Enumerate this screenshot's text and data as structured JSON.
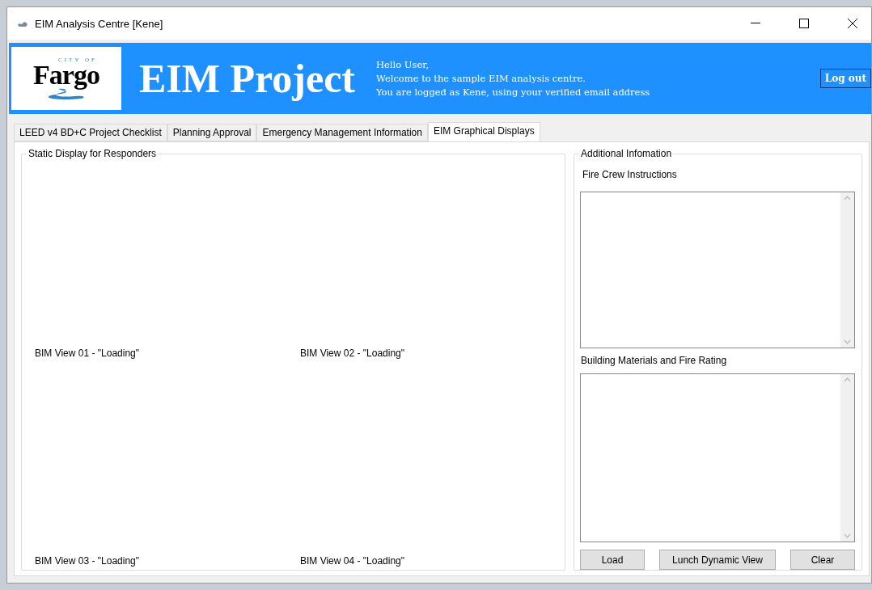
{
  "window": {
    "title": "EIM Analysis Centre  [Kene]"
  },
  "banner": {
    "logo_small": "CITY OF",
    "logo_main": "Fargo",
    "title": "EIM Project",
    "greeting": [
      "Hello User,",
      "Welcome to the sample EIM analysis centre.",
      "You are logged as Kene, using your verified email address"
    ],
    "logout": "Log out"
  },
  "tabs": [
    {
      "label": "LEED v4 BD+C Project Checklist",
      "selected": false
    },
    {
      "label": "Planning Approval",
      "selected": false
    },
    {
      "label": "Emergency Management Information",
      "selected": false
    },
    {
      "label": "EIM Graphical Displays",
      "selected": true
    }
  ],
  "static_display": {
    "title": "Static Display for Responders",
    "views": [
      "BIM View 01 - \"Loading\"",
      "BIM View 02 - \"Loading\"",
      "BIM View 03 - \"Loading\"",
      "BIM View 04 - \"Loading\""
    ]
  },
  "additional": {
    "title": "Additional Infomation",
    "fields": [
      {
        "label": "Fire Crew Instructions"
      },
      {
        "label": "Building Materials and Fire Rating"
      }
    ],
    "buttons": [
      "Load",
      "Lunch Dynamic View",
      "Clear"
    ]
  }
}
